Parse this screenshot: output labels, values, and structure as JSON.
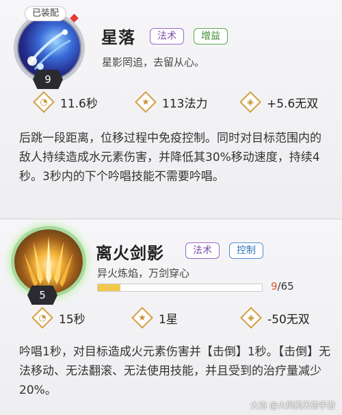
{
  "skills": [
    {
      "equipped_label": "已装配",
      "level": "9",
      "name": "星落",
      "tags": [
        "法术",
        "增益"
      ],
      "subtitle": "星影罔追，去留从心。",
      "stats": [
        {
          "icon": "clock-icon",
          "value": "11.6秒"
        },
        {
          "icon": "star-icon",
          "value": "113法力"
        },
        {
          "icon": "invincible-icon",
          "value": "+5.6无双"
        }
      ],
      "description": "后跳一段距离，位移过程中免疫控制。同时对目标范围内的敌人持续造成水元素伤害，并降低其30%移动速度，持续4秒。3秒内的下个吟唱技能不需要吟唱。"
    },
    {
      "level": "5",
      "name": "离火剑影",
      "tags": [
        "法术",
        "控制"
      ],
      "subtitle": "异火炼焰，万剑穿心",
      "progress": {
        "current": "9",
        "total": "65",
        "fraction": 0.138
      },
      "stats": [
        {
          "icon": "clock-icon",
          "value": "15秒"
        },
        {
          "icon": "star-icon",
          "value": "1星"
        },
        {
          "icon": "invincible-icon",
          "value": "-50无双"
        }
      ],
      "description": "吟唱1秒，对目标造成火元素伤害并【击倒】1秒。【击倒】无法移动、无法翻滚、无法使用技能，并且受到的治疗量减少20%。"
    }
  ],
  "watermark": "大泊 @火凤鹘天倚手游",
  "colors": {
    "progress_fill": "#f2c94c",
    "progress_current": "#e05a2a",
    "tag_magic": "#9a66c9",
    "tag_buff": "#5aa84a",
    "tag_control": "#4d8fd6"
  }
}
